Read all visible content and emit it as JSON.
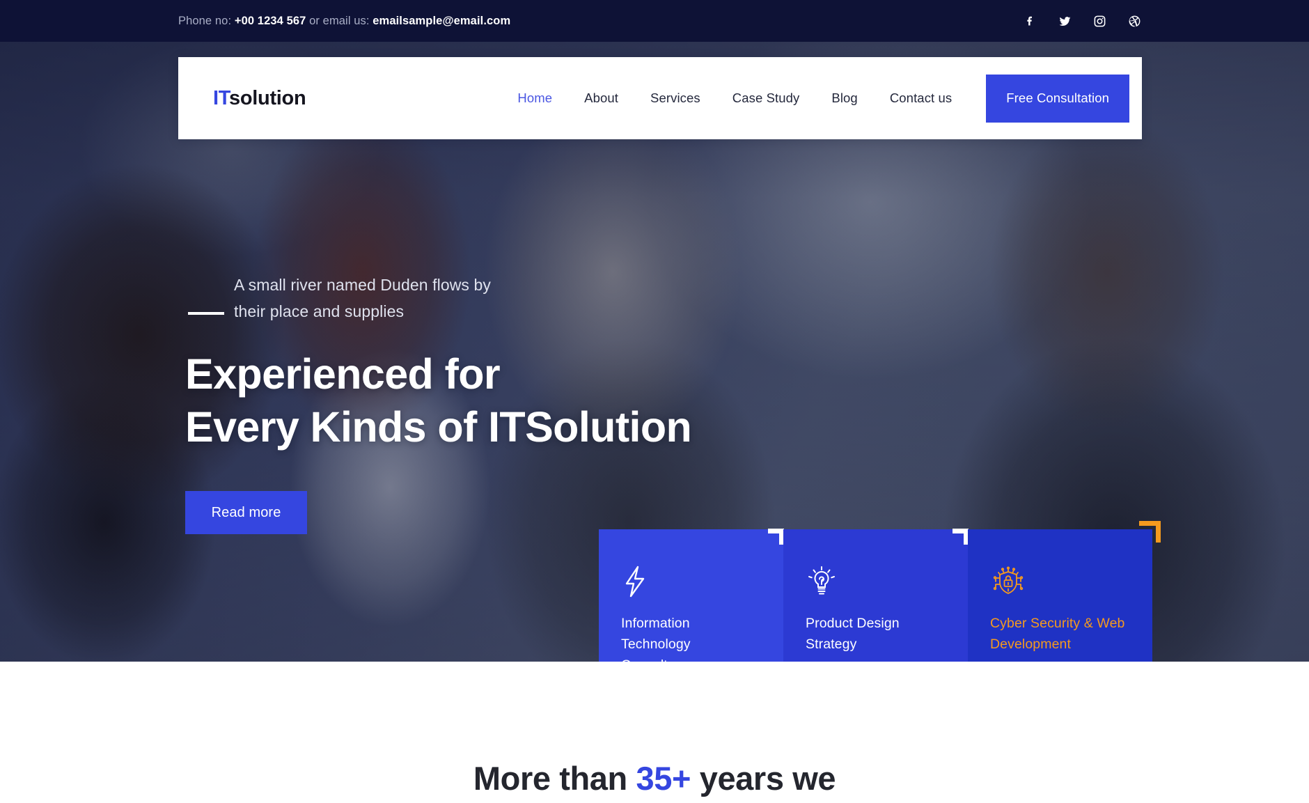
{
  "topbar": {
    "contact_prefix": "Phone no: ",
    "phone": "+00 1234 567",
    "contact_middle": " or email us: ",
    "email": "emailsample@email.com",
    "socials": [
      {
        "name": "facebook-icon",
        "label": "Facebook"
      },
      {
        "name": "twitter-icon",
        "label": "Twitter"
      },
      {
        "name": "instagram-icon",
        "label": "Instagram"
      },
      {
        "name": "dribbble-icon",
        "label": "Dribbble"
      }
    ],
    "background_color": "#0e1236"
  },
  "nav": {
    "logo_accent": "IT",
    "logo_rest": "solution",
    "logo_accent_color": "#3546e0",
    "links": [
      {
        "label": "Home",
        "active": true
      },
      {
        "label": "About",
        "active": false
      },
      {
        "label": "Services",
        "active": false
      },
      {
        "label": "Case Study",
        "active": false
      },
      {
        "label": "Blog",
        "active": false
      },
      {
        "label": "Contact us",
        "active": false
      }
    ],
    "cta_label": "Free Consultation",
    "cta_color": "#3546e0"
  },
  "hero": {
    "eyebrow_line1": "A small river named Duden flows by",
    "eyebrow_line2": "their place and supplies",
    "headline_line1": "Experienced for",
    "headline_line2": "Every Kinds of ITSolution",
    "button_label": "Read more",
    "button_color": "#3546e0"
  },
  "cards": [
    {
      "icon": "bolt-icon",
      "title": "Information Technology Consultancy",
      "bg": "#3546e0",
      "text_color": "#ffffff",
      "corner_color": "#ffffff"
    },
    {
      "icon": "lightbulb-icon",
      "title": "Product Design Strategy",
      "bg": "#2c3ad3",
      "text_color": "#ffffff",
      "corner_color": "#ffffff"
    },
    {
      "icon": "cyber-shield-lock-icon",
      "title": "Cyber Security & Web Development",
      "bg": "#1f32c4",
      "text_color": "#f59a1e",
      "corner_color": "#f59a1e"
    }
  ],
  "below": {
    "title_part1": "More than ",
    "title_accent": "35+",
    "title_part2": " years we",
    "accent_color": "#3546e0"
  }
}
